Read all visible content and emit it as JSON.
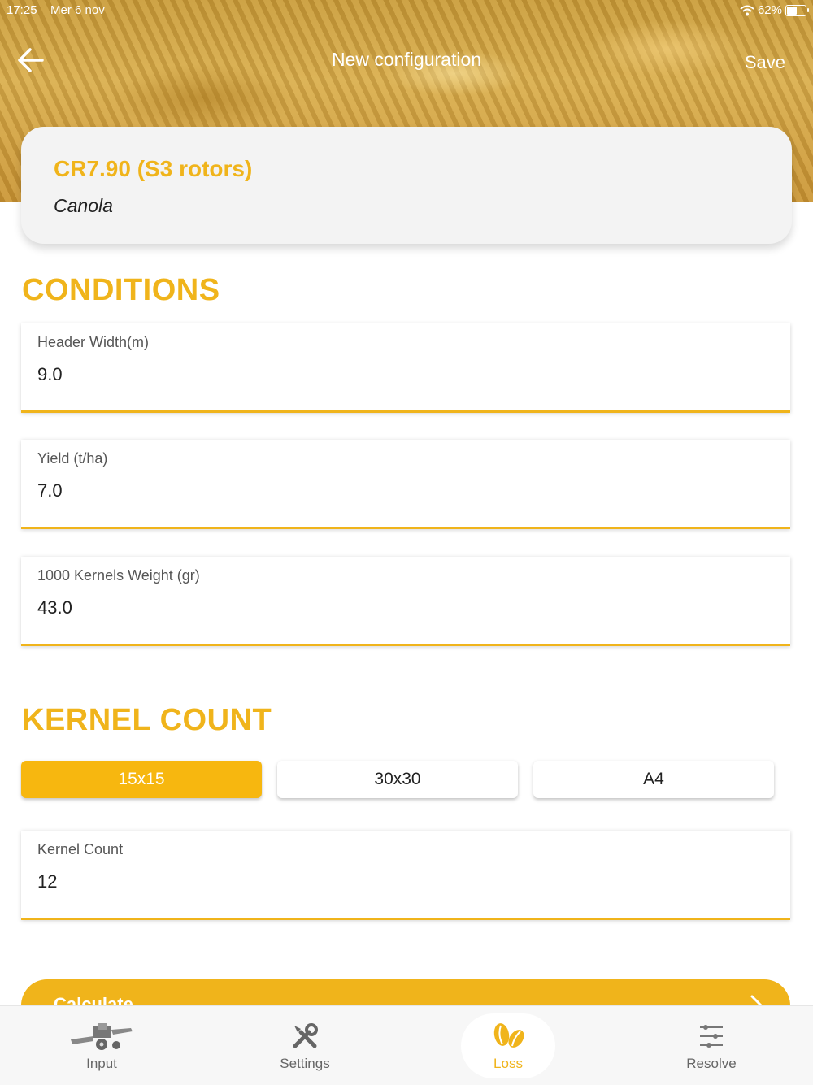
{
  "status": {
    "time": "17:25",
    "date": "Mer 6 nov",
    "battery_text": "62%",
    "battery_level": 0.62
  },
  "nav": {
    "title": "New configuration",
    "save_label": "Save"
  },
  "machine": {
    "name": "CR7.90 (S3 rotors)",
    "crop": "Canola"
  },
  "conditions": {
    "title": "CONDITIONS",
    "fields": [
      {
        "label": "Header Width(m)",
        "value": "9.0"
      },
      {
        "label": "Yield  (t/ha)",
        "value": "7.0"
      },
      {
        "label": "1000 Kernels Weight  (gr)",
        "value": "43.0"
      }
    ]
  },
  "kernel": {
    "title": "KERNEL COUNT",
    "segments": [
      "15x15",
      "30x30",
      "A4"
    ],
    "selected": "15x15",
    "count_label": "Kernel Count",
    "count_value": "12"
  },
  "calculate_label": "Calculate",
  "tabs": [
    {
      "label": "Input",
      "icon": "combine-harvester-icon"
    },
    {
      "label": "Settings",
      "icon": "tools-icon"
    },
    {
      "label": "Loss",
      "icon": "grain-icon",
      "active": true
    },
    {
      "label": "Resolve",
      "icon": "sliders-icon"
    }
  ],
  "colors": {
    "accent": "#f0b41b"
  }
}
